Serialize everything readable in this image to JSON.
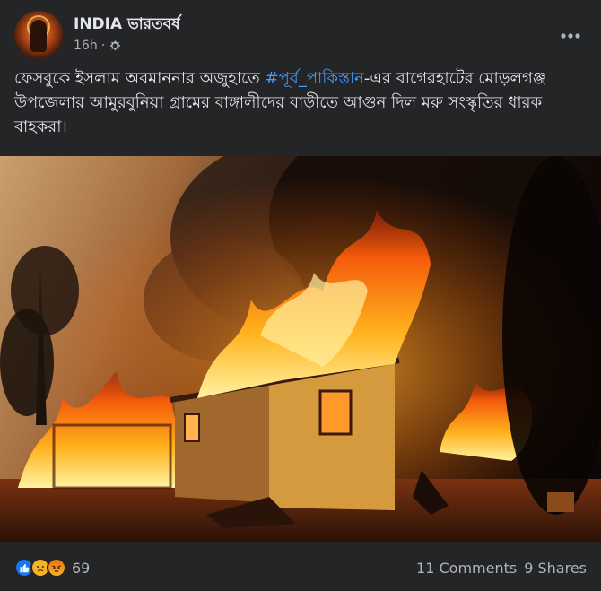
{
  "post": {
    "page_name": "INDIA ভারতবর্ষ",
    "time": "16h",
    "separator": "·",
    "audience_icon": "gear-icon",
    "more_icon": "more-options-icon",
    "text_before": "ফেসবুকে ইসলাম অবমাননার অজুহাতে ",
    "hashtag": "#পূর্ব_পাকিস্তান",
    "text_after": "-এর বাগেরহাটের মোড়লগঞ্জ উপজেলার আমুরবুনিয়া গ্রামের বাঙ্গালীদের বাড়ীতে আগুন দিল মরু সংস্কৃতির ধারক বাহকরা।",
    "photo_subject": "house fire"
  },
  "reactions": {
    "icons": [
      "like-icon",
      "sad-icon",
      "angry-icon"
    ],
    "count": "69"
  },
  "stats": {
    "comments": "11 Comments",
    "shares": "9 Shares"
  },
  "colors": {
    "background": "#242526",
    "text": "#e4e6eb",
    "secondary_text": "#b0b3b8",
    "hashtag": "#4599ff",
    "like": "#1877f2",
    "sad": "#f7b125"
  }
}
